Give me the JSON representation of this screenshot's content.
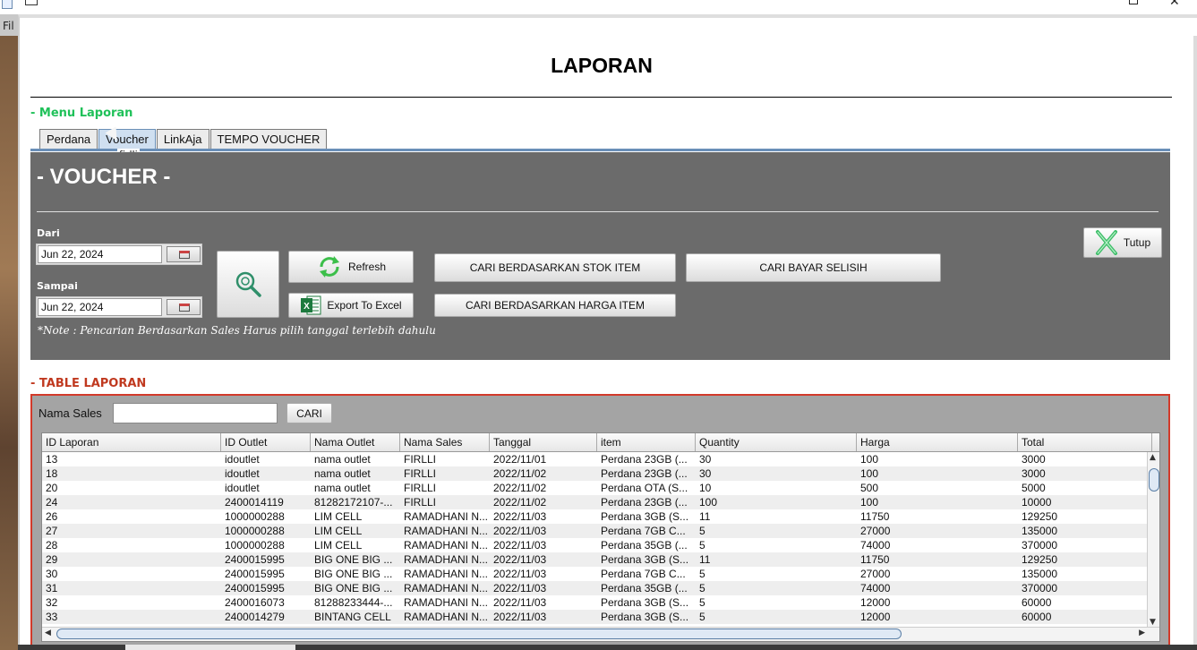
{
  "desktop": {
    "left_partial_text": "Fil"
  },
  "page_title": "LAPORAN",
  "menu_label": "- Menu Laporan",
  "tabs": [
    {
      "label": "Perdana",
      "active": false
    },
    {
      "label": "Voucher",
      "active": true
    },
    {
      "label": "LinkAja",
      "active": false
    },
    {
      "label": "TEMPO VOUCHER",
      "active": false
    }
  ],
  "tooltip": "firlli",
  "voucher": {
    "title": "- VOUCHER -",
    "dari_label": "Dari",
    "dari_value": "Jun 22, 2024",
    "sampai_label": "Sampai",
    "sampai_value": "Jun 22, 2024",
    "refresh_label": "Refresh",
    "export_label": "Export To Excel",
    "stok_label": "CARI BERDASARKAN STOK ITEM",
    "harga_label": "CARI BERDASARKAN HARGA ITEM",
    "selisih_label": "CARI BAYAR SELISIH",
    "tutup_label": "Tutup",
    "note": "*Note : Pencarian Berdasarkan Sales Harus pilih tanggal terlebih dahulu"
  },
  "table_label": "- TABLE LAPORAN",
  "table": {
    "nama_sales_label": "Nama Sales",
    "nama_sales_value": "",
    "cari_label": "CARI",
    "columns": [
      "ID Laporan",
      "ID Outlet",
      "Nama Outlet",
      "Nama Sales",
      "Tanggal",
      "item",
      "Quantity",
      "Harga",
      "Total"
    ],
    "rows": [
      [
        "13",
        "idoutlet",
        "nama outlet",
        "FIRLLI",
        "2022/11/01",
        "Perdana 23GB (...",
        "30",
        "100",
        "3000"
      ],
      [
        "18",
        "idoutlet",
        "nama outlet",
        "FIRLLI",
        "2022/11/02",
        "Perdana 23GB (...",
        "30",
        "100",
        "3000"
      ],
      [
        "20",
        "idoutlet",
        "nama outlet",
        "FIRLLI",
        "2022/11/02",
        "Perdana OTA (S...",
        "10",
        "500",
        "5000"
      ],
      [
        "24",
        "2400014119",
        "81282172107-...",
        "FIRLLI",
        "2022/11/02",
        "Perdana 23GB (...",
        "100",
        "100",
        "10000"
      ],
      [
        "26",
        "1000000288",
        "LIM CELL",
        "RAMADHANI N...",
        "2022/11/03",
        "Perdana 3GB (S...",
        "11",
        "11750",
        "129250"
      ],
      [
        "27",
        "1000000288",
        "LIM CELL",
        "RAMADHANI N...",
        "2022/11/03",
        "Perdana 7GB C...",
        "5",
        "27000",
        "135000"
      ],
      [
        "28",
        "1000000288",
        "LIM CELL",
        "RAMADHANI N...",
        "2022/11/03",
        "Perdana 35GB (...",
        "5",
        "74000",
        "370000"
      ],
      [
        "29",
        "2400015995",
        "BIG ONE BIG ...",
        "RAMADHANI N...",
        "2022/11/03",
        "Perdana 3GB (S...",
        "11",
        "11750",
        "129250"
      ],
      [
        "30",
        "2400015995",
        "BIG ONE BIG ...",
        "RAMADHANI N...",
        "2022/11/03",
        "Perdana 7GB C...",
        "5",
        "27000",
        "135000"
      ],
      [
        "31",
        "2400015995",
        "BIG ONE BIG ...",
        "RAMADHANI N...",
        "2022/11/03",
        "Perdana 35GB (...",
        "5",
        "74000",
        "370000"
      ],
      [
        "32",
        "2400016073",
        "81288233444-...",
        "RAMADHANI N...",
        "2022/11/03",
        "Perdana 3GB (S...",
        "5",
        "12000",
        "60000"
      ],
      [
        "33",
        "2400014279",
        "BINTANG CELL",
        "RAMADHANI N...",
        "2022/11/03",
        "Perdana 3GB (S...",
        "5",
        "12000",
        "60000"
      ]
    ]
  },
  "colors": {
    "menu_label": "#1fc159",
    "table_label": "#c0391f",
    "panel_bg": "#6b6b6b",
    "table_border": "#d23a2a"
  }
}
